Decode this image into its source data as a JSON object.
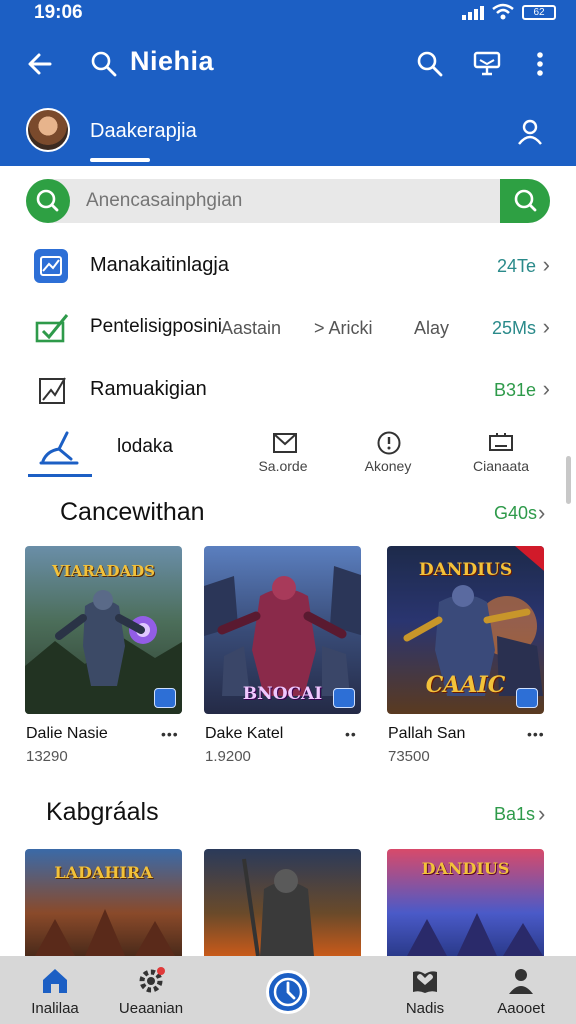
{
  "status": {
    "time": "19:06",
    "battery": "62"
  },
  "topbar": {
    "title": "Niehia"
  },
  "subbar": {
    "name": "Daakerapjia"
  },
  "search": {
    "placeholder": "Anencasainphgian"
  },
  "rows": [
    {
      "label": "Manakaitinlagja",
      "count": "24Te",
      "icon": "image-check-icon"
    },
    {
      "label": "Pentelisigposini",
      "extra1": "Aastain",
      "extra2": "> Aricki",
      "extra3": "Alay",
      "count": "25Ms",
      "icon": "check-chart-icon"
    },
    {
      "label": "Ramuakigian",
      "count": "B31e",
      "icon": "edit-image-icon"
    }
  ],
  "tabs": [
    {
      "label": "lodaka",
      "icon": "pen-tool-icon"
    },
    {
      "label": "Sa.orde",
      "icon": "mail-icon"
    },
    {
      "label": "Akoney",
      "icon": "alert-clock-icon"
    },
    {
      "label": "Cianaata",
      "icon": "screen-icon"
    }
  ],
  "section1": {
    "title": "Cancewithan",
    "link": "G40s",
    "cards": [
      {
        "title": "Dalie Nasie",
        "sub": "13290",
        "art": "VIARADADS"
      },
      {
        "title": "Dake Katel",
        "sub": "1.9200",
        "art": "BNOCAI"
      },
      {
        "title": "Pallah San",
        "sub": "73500",
        "art_top": "DANDIUS",
        "art_bottom": "CAAIC"
      }
    ]
  },
  "section2": {
    "title": "Kabgráals",
    "link": "Ba1s",
    "cards": [
      {
        "art": "LADAHIRA"
      },
      {
        "art": ""
      },
      {
        "art": "DANDIUS"
      }
    ]
  },
  "nav": [
    {
      "label": "Inalilaa",
      "icon": "home-icon"
    },
    {
      "label": "Ueaanian",
      "icon": "settings-gear-icon"
    },
    {
      "label": "",
      "icon": "clock-icon"
    },
    {
      "label": "Nadis",
      "icon": "book-heart-icon"
    },
    {
      "label": "Aaooet",
      "icon": "profile-icon"
    }
  ],
  "colors": {
    "primary": "#1c5fc4",
    "accent": "#2ea043",
    "count": "#2a8a8a"
  }
}
